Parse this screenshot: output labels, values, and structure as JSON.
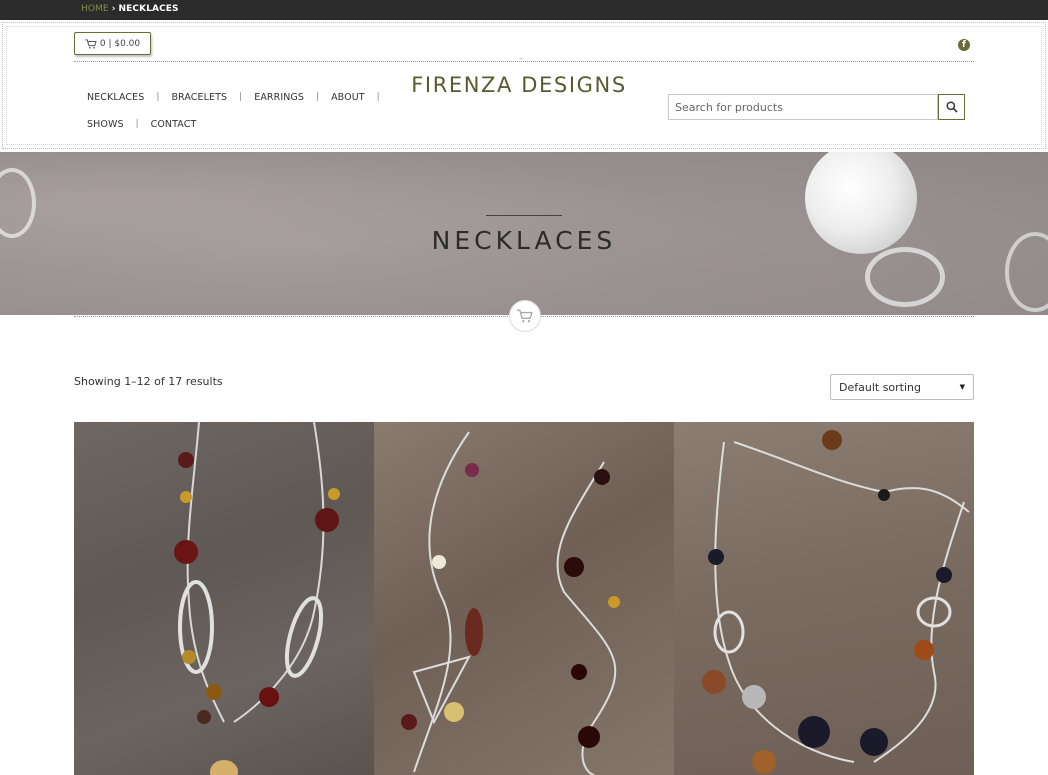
{
  "breadcrumb": {
    "home": "HOME",
    "separator": "›",
    "current": "NECKLACES"
  },
  "cart": {
    "summary": "0 | $0.00"
  },
  "social": {
    "facebook_glyph": "f"
  },
  "brand": {
    "name": "FIRENZA DESIGNS",
    "color": "#5a5a30"
  },
  "nav": {
    "items": [
      "NECKLACES",
      "BRACELETS",
      "EARRINGS",
      "ABOUT",
      "SHOWS",
      "CONTACT"
    ],
    "separator": "|"
  },
  "search": {
    "placeholder": "Search for products"
  },
  "hero": {
    "title": "NECKLACES"
  },
  "shop": {
    "results_text": "Showing 1–12 of 17 results",
    "sort_selected": "Default sorting"
  },
  "products": [
    {
      "image_alt": "necklace-1"
    },
    {
      "image_alt": "necklace-2"
    },
    {
      "image_alt": "necklace-3"
    }
  ],
  "colors": {
    "accent": "#6b6b3a",
    "topbar": "#2b2b2b"
  }
}
